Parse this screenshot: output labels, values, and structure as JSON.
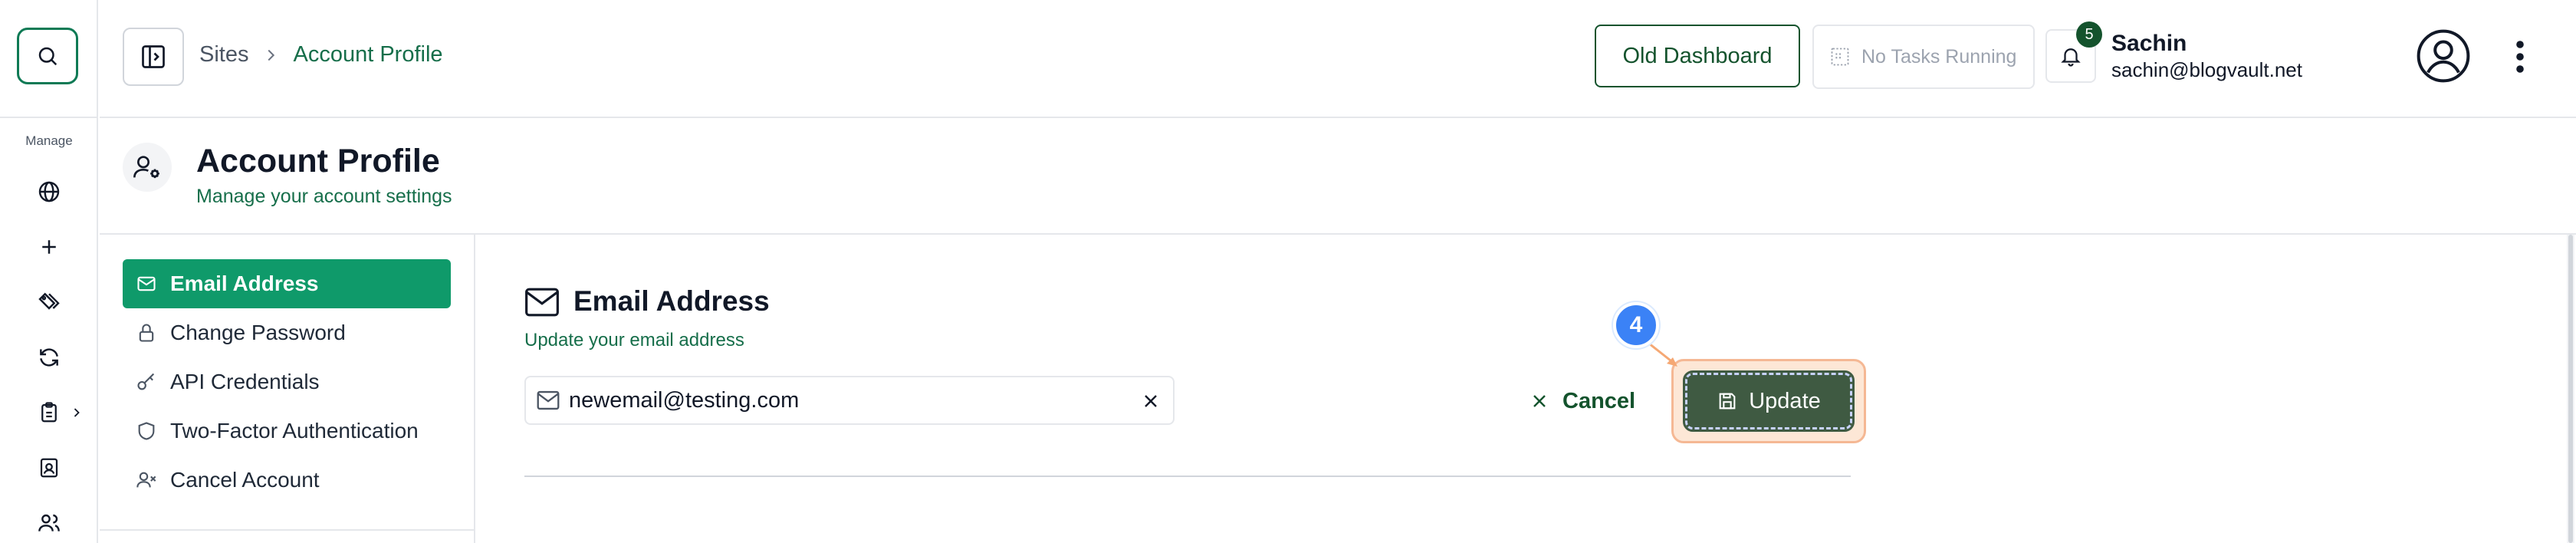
{
  "rail": {
    "section_label": "Manage",
    "icons": [
      "globe-icon",
      "plus-icon",
      "tags-icon",
      "refresh-icon",
      "clipboard-icon",
      "id-badge-icon",
      "users-icon"
    ]
  },
  "header": {
    "breadcrumb": {
      "root": "Sites",
      "current": "Account Profile"
    },
    "old_dashboard_label": "Old Dashboard",
    "tasks_label": "No Tasks Running",
    "notification_count": "5",
    "user": {
      "name": "Sachin",
      "email": "sachin@blogvault.net"
    }
  },
  "page": {
    "title": "Account Profile",
    "subtitle": "Manage your account settings"
  },
  "settings_nav": {
    "items": [
      {
        "label": "Email Address",
        "icon": "mail-icon",
        "active": true
      },
      {
        "label": "Change Password",
        "icon": "lock-icon",
        "active": false
      },
      {
        "label": "API Credentials",
        "icon": "key-icon",
        "active": false
      },
      {
        "label": "Two-Factor Authentication",
        "icon": "shield-icon",
        "active": false
      },
      {
        "label": "Cancel Account",
        "icon": "user-x-icon",
        "active": false
      }
    ]
  },
  "email_section": {
    "title": "Email Address",
    "subtitle": "Update your email address",
    "email_value": "newemail@testing.com",
    "cancel_label": "Cancel",
    "update_label": "Update"
  },
  "tutorial": {
    "step": "4"
  },
  "colors": {
    "brand_green": "#166e4a",
    "active_nav": "#0f9a6a",
    "update_button": "#3f5a42",
    "highlight_ring": "#f5b894",
    "step_badge": "#3b82f6"
  }
}
